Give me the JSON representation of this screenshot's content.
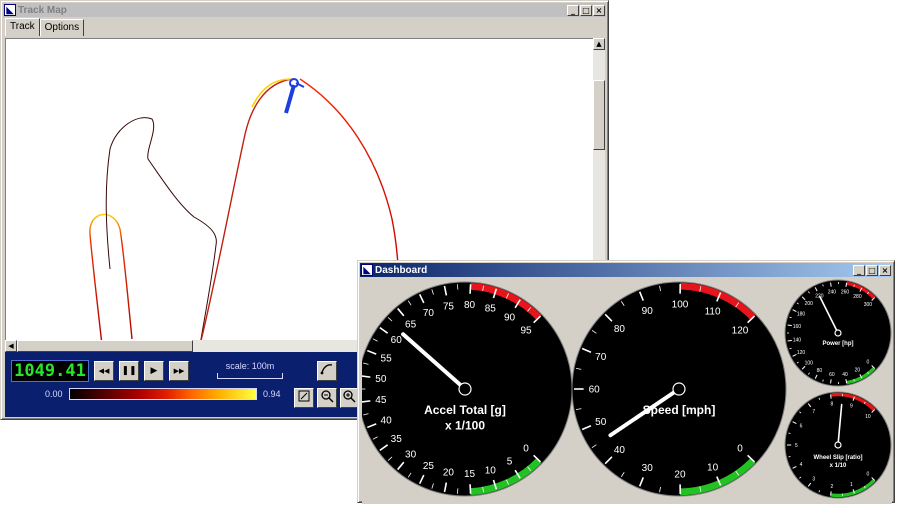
{
  "track_window": {
    "title": "Track Map",
    "tabs": [
      {
        "label": "Track"
      },
      {
        "label": "Options"
      }
    ],
    "controls": {
      "minimize": "_",
      "maximize": "□",
      "close": "×"
    },
    "lcd_value": "1049.41",
    "playback": {
      "rewind": "◀◀",
      "pause": "❚❚",
      "play": "▶",
      "fast_forward": "▶▶"
    },
    "scale_label": "scale: 100m",
    "colorbar": {
      "min": "0.00",
      "max": "0.94"
    }
  },
  "dashboard_window": {
    "title": "Dashboard",
    "controls": {
      "minimize": "_",
      "maximize": "□",
      "close": "×"
    },
    "gauges": [
      {
        "name": "accel",
        "title": "Accel Total [g]",
        "subtitle": "x 1/100",
        "ticks": [
          "95",
          "90",
          "85",
          "80",
          "75",
          "70",
          "65",
          "60",
          "55",
          "50",
          "45",
          "40",
          "35",
          "30",
          "25",
          "20",
          "15",
          "10",
          "5",
          "0"
        ],
        "value": 62
      },
      {
        "name": "speed",
        "title": "Speed [mph]",
        "subtitle": "",
        "ticks": [
          "120",
          "110",
          "100",
          "90",
          "80",
          "70",
          "60",
          "50",
          "40",
          "30",
          "20",
          "10",
          "0"
        ],
        "value": 45
      },
      {
        "name": "power",
        "title": "Power [hp]",
        "subtitle": "",
        "ticks": [
          "300",
          "280",
          "260",
          "240",
          "220",
          "200",
          "180",
          "160",
          "140",
          "120",
          "100",
          "80",
          "60",
          "40",
          "20",
          "0"
        ],
        "value": 220
      },
      {
        "name": "wheel_slip",
        "title": "Wheel Slip [ratio]",
        "subtitle": "x 1/10",
        "ticks": [
          "10",
          "9",
          "8",
          "7",
          "6",
          "5",
          "4",
          "3",
          "2",
          "1",
          "0"
        ],
        "value": 8.5
      }
    ]
  },
  "colors": {
    "lcd_text": "#27e627",
    "panel_bg": "#0a1f6e",
    "gauge_red": "#e8141c",
    "gauge_green": "#22c222",
    "needle": "#ffffff",
    "track_cursor": "#1e3ee0"
  }
}
